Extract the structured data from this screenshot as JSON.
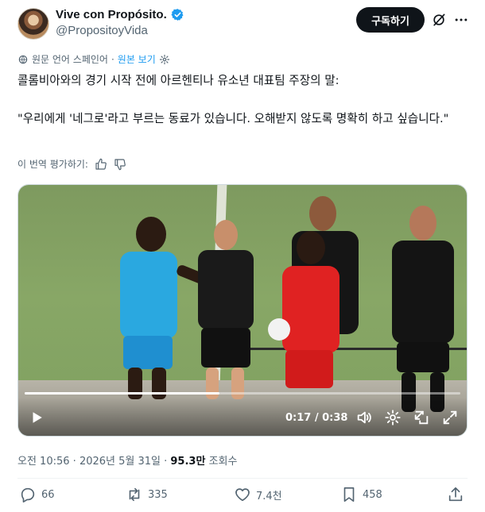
{
  "author": {
    "display_name": "Vive con Propósito.",
    "handle": "@PropositoyVida",
    "verified_color": "#1d9bf0"
  },
  "header": {
    "subscribe_label": "구독하기"
  },
  "translation": {
    "source_label": "원문 언어 스페인어",
    "view_original": "원본 보기"
  },
  "tweet": {
    "line1": "콜롬비아와의 경기 시작 전에 아르헨티나 유소년 대표팀 주장의 말:",
    "line2": "\"우리에게 '네그로'라고 부르는 동료가 있습니다. 오해받지 않도록 명확히 하고 싶습니다.\""
  },
  "rating": {
    "label": "이 번역 평가하기:"
  },
  "video": {
    "time": "0:17 / 0:38",
    "progress": 0.447
  },
  "meta": {
    "time": "오전 10:56",
    "date": "2026년 5월 31일",
    "views_count": "95.3만",
    "views_label": "조회수"
  },
  "actions": {
    "replies": "66",
    "reposts": "335",
    "likes": "7.4천",
    "bookmarks": "458"
  },
  "icons": [
    "verified-icon",
    "grok-icon",
    "more-icon",
    "translate-icon",
    "gear-icon",
    "thumbs-up-icon",
    "thumbs-down-icon",
    "play-icon",
    "volume-icon",
    "settings-icon",
    "pip-icon",
    "fullscreen-icon",
    "reply-icon",
    "repost-icon",
    "like-icon",
    "bookmark-icon",
    "share-icon"
  ]
}
